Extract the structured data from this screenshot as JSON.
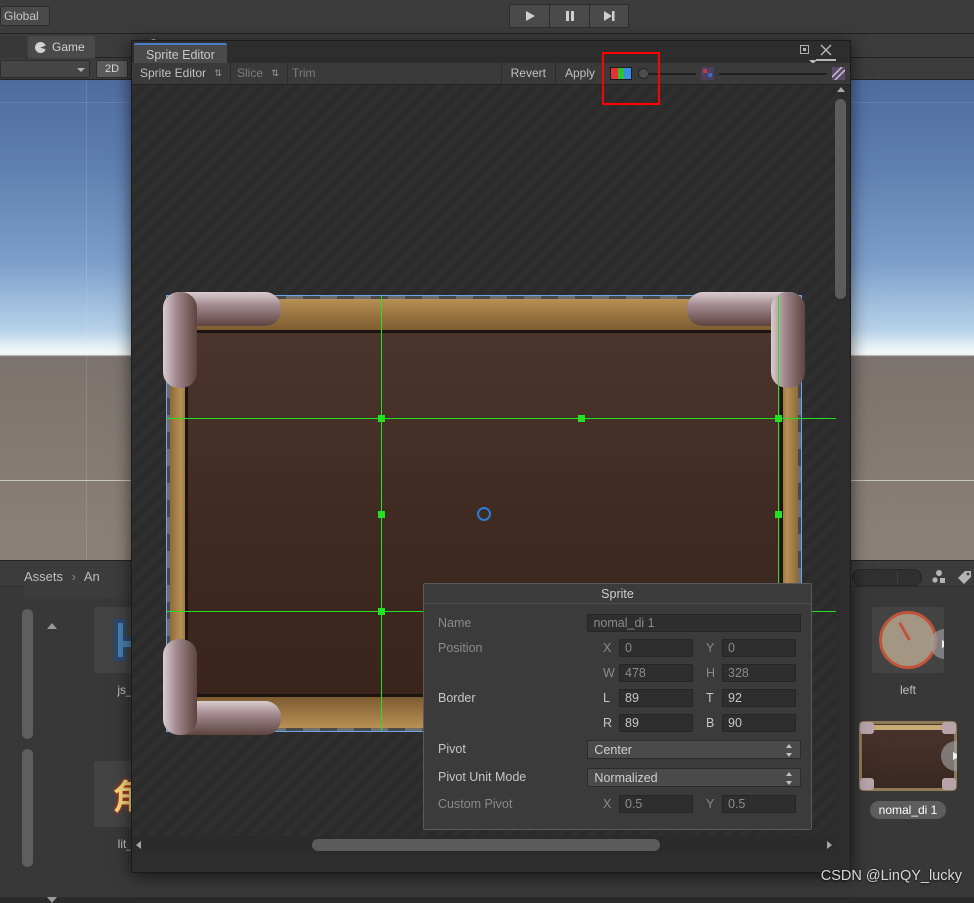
{
  "editor": {
    "global_button": "Global",
    "playback": {
      "play": "play-icon",
      "pause": "pause-icon",
      "step": "step-icon"
    },
    "tabs": {
      "scene": "e",
      "game": "Game"
    },
    "gameview": {
      "display_dropdown": "",
      "aspect_toggle": "2D"
    }
  },
  "project": {
    "breadcrumb_root": "Assets",
    "breadcrumb_sep": "›",
    "breadcrumb_current": "An",
    "assets": [
      {
        "label": "js_to",
        "icon": "folder-blue-icon"
      },
      {
        "label": "lit_ju",
        "icon": "chinese-text-icon"
      },
      {
        "label": "left",
        "icon": "compass-icon"
      },
      {
        "label": "nomal_di 1",
        "icon": "sprite-frame-icon",
        "selected": true
      }
    ]
  },
  "sprite_editor": {
    "window_title": "Sprite Editor",
    "toolbar": {
      "mode": "Sprite Editor",
      "slice": "Slice",
      "trim": "Trim",
      "revert": "Revert",
      "apply": "Apply",
      "rgb_swatch": "rgb-channel-icon",
      "alpha_icon": "alpha-icon",
      "grid_icon": "grid-icon"
    },
    "window_controls": {
      "maximize": "maximize-icon",
      "close": "close-icon",
      "menu": "menu-icon"
    }
  },
  "sprite_panel": {
    "title": "Sprite",
    "name_label": "Name",
    "name_value": "nomal_di 1",
    "position_label": "Position",
    "position_x_axis": "X",
    "position_x": "0",
    "position_y_axis": "Y",
    "position_y": "0",
    "size_w_axis": "W",
    "size_w": "478",
    "size_h_axis": "H",
    "size_h": "328",
    "border_label": "Border",
    "border_l_axis": "L",
    "border_l": "89",
    "border_t_axis": "T",
    "border_t": "92",
    "border_r_axis": "R",
    "border_r": "89",
    "border_b_axis": "B",
    "border_b": "90",
    "pivot_label": "Pivot",
    "pivot_value": "Center",
    "pivot_unit_label": "Pivot Unit Mode",
    "pivot_unit_value": "Normalized",
    "custom_pivot_label": "Custom Pivot",
    "custom_pivot_x_axis": "X",
    "custom_pivot_x": "0.5",
    "custom_pivot_y_axis": "Y",
    "custom_pivot_y": "0.5"
  },
  "annotation": {
    "highlight_color": "#ff0000",
    "target": "apply-button"
  },
  "watermark": "CSDN @LinQY_lucky"
}
